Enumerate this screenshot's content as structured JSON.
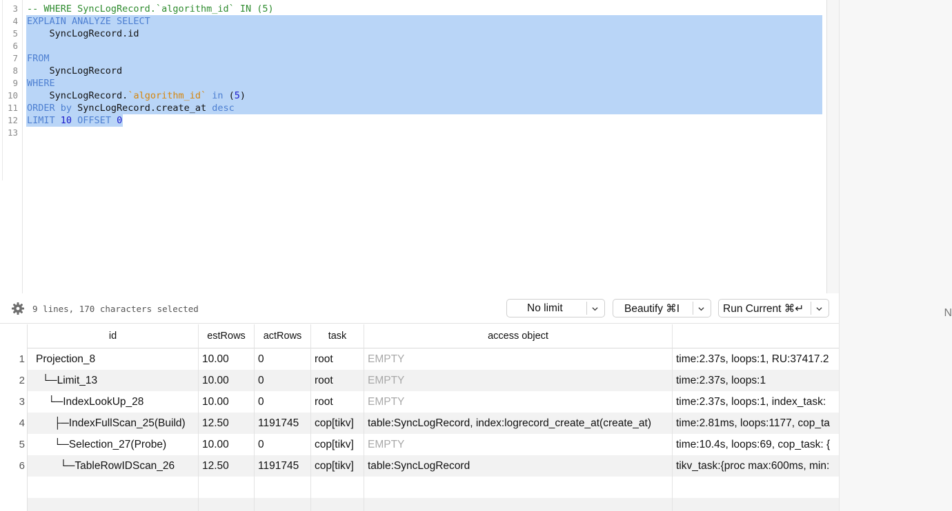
{
  "editor": {
    "lines": [
      {
        "num": "3",
        "tokens": [
          {
            "t": "-- WHERE SyncLogRecord.`algorithm_id` IN (5)",
            "c": "c"
          }
        ]
      },
      {
        "num": "4",
        "tokens": [
          {
            "t": "EXPLAIN ANALYZE SELECT",
            "c": "k"
          }
        ]
      },
      {
        "num": "5",
        "tokens": [
          {
            "t": "    SyncLogRecord.id",
            "c": "p"
          }
        ]
      },
      {
        "num": "6",
        "tokens": []
      },
      {
        "num": "7",
        "tokens": [
          {
            "t": "FROM",
            "c": "k"
          }
        ]
      },
      {
        "num": "8",
        "tokens": [
          {
            "t": "    SyncLogRecord",
            "c": "p"
          }
        ]
      },
      {
        "num": "9",
        "tokens": [
          {
            "t": "WHERE",
            "c": "k"
          }
        ]
      },
      {
        "num": "10",
        "tokens": [
          {
            "t": "    SyncLogRecord.",
            "c": "p"
          },
          {
            "t": "`algorithm_id`",
            "c": "s"
          },
          {
            "t": " in ",
            "c": "k"
          },
          {
            "t": "(",
            "c": "p"
          },
          {
            "t": "5",
            "c": "n"
          },
          {
            "t": ")",
            "c": "p"
          }
        ]
      },
      {
        "num": "11",
        "tokens": [
          {
            "t": "ORDER by ",
            "c": "k"
          },
          {
            "t": "SyncLogRecord.create_at ",
            "c": "p"
          },
          {
            "t": "desc",
            "c": "k"
          }
        ]
      },
      {
        "num": "12",
        "tokens": [
          {
            "t": "LIMIT ",
            "c": "k"
          },
          {
            "t": "10",
            "c": "n"
          },
          {
            "t": " OFFSET ",
            "c": "k"
          },
          {
            "t": "0",
            "c": "n"
          }
        ]
      },
      {
        "num": "13",
        "tokens": []
      }
    ],
    "selection": {
      "first_line": "4",
      "last_line": "12"
    }
  },
  "toolbar": {
    "status": "9 lines, 170 characters selected",
    "limit_label": "No limit",
    "beautify_label": "Beautify ⌘I",
    "run_label": "Run Current ⌘↵"
  },
  "grid": {
    "columns": [
      "id",
      "estRows",
      "actRows",
      "task",
      "access object",
      ""
    ],
    "rows": [
      {
        "n": "1",
        "id": "Projection_8",
        "estRows": "10.00",
        "actRows": "0",
        "task": "root",
        "access": "EMPTY",
        "info": "time:2.37s, loops:1, RU:37417.2"
      },
      {
        "n": "2",
        "id": "  └─Limit_13",
        "estRows": "10.00",
        "actRows": "0",
        "task": "root",
        "access": "EMPTY",
        "info": "time:2.37s, loops:1"
      },
      {
        "n": "3",
        "id": "    └─IndexLookUp_28",
        "estRows": "10.00",
        "actRows": "0",
        "task": "root",
        "access": "EMPTY",
        "info": "time:2.37s, loops:1, index_task:"
      },
      {
        "n": "4",
        "id": "      ├─IndexFullScan_25(Build)",
        "estRows": "12.50",
        "actRows": "1191745",
        "task": "cop[tikv]",
        "access": "table:SyncLogRecord, index:logrecord_create_at(create_at)",
        "info": "time:2.81ms, loops:1177, cop_ta"
      },
      {
        "n": "5",
        "id": "      └─Selection_27(Probe)",
        "estRows": "10.00",
        "actRows": "0",
        "task": "cop[tikv]",
        "access": "EMPTY",
        "info": "time:10.4s, loops:69, cop_task: {"
      },
      {
        "n": "6",
        "id": "        └─TableRowIDScan_26",
        "estRows": "12.50",
        "actRows": "1191745",
        "task": "cop[tikv]",
        "access": "table:SyncLogRecord",
        "info": "tikv_task:{proc max:600ms, min:"
      }
    ]
  },
  "right_pane": {
    "edge_text": "N"
  },
  "colors": {
    "selection": "#b9d5f7",
    "keyword": "#4d7fd1",
    "comment": "#2e8b2e",
    "string": "#d5860e",
    "number": "#1a1acc"
  }
}
